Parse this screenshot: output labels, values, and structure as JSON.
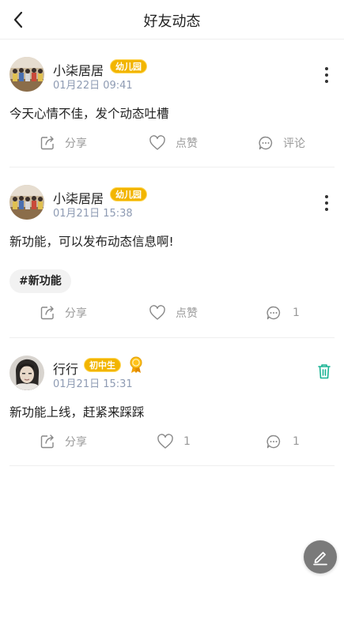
{
  "header": {
    "title": "好友动态"
  },
  "posts": [
    {
      "username": "小柒居居",
      "badge": "幼儿园",
      "time": "01月22日 09:41",
      "content": "今天心情不佳，发个动态吐槽",
      "tag": "",
      "share_label": "分享",
      "like_label": "点赞",
      "comment_label": "评论"
    },
    {
      "username": "小柒居居",
      "badge": "幼儿园",
      "time": "01月21日 15:38",
      "content": "新功能，可以发布动态信息啊!",
      "tag": "#新功能",
      "share_label": "分享",
      "like_label": "点赞",
      "comment_label": "1"
    },
    {
      "username": "行行",
      "badge": "初中生",
      "time": "01月21日 15:31",
      "content": "新功能上线，赶紧来踩踩",
      "tag": "",
      "share_label": "分享",
      "like_label": "1",
      "comment_label": "1"
    }
  ],
  "colors": {
    "badge": "#f2b500",
    "timestamp": "#8e9bb3",
    "delete": "#19b394",
    "fab": "#7a7a7a"
  },
  "icons": [
    "back-arrow-icon",
    "more-icon",
    "share-icon",
    "heart-icon",
    "comment-icon",
    "trash-icon",
    "medal-icon",
    "edit-icon"
  ]
}
